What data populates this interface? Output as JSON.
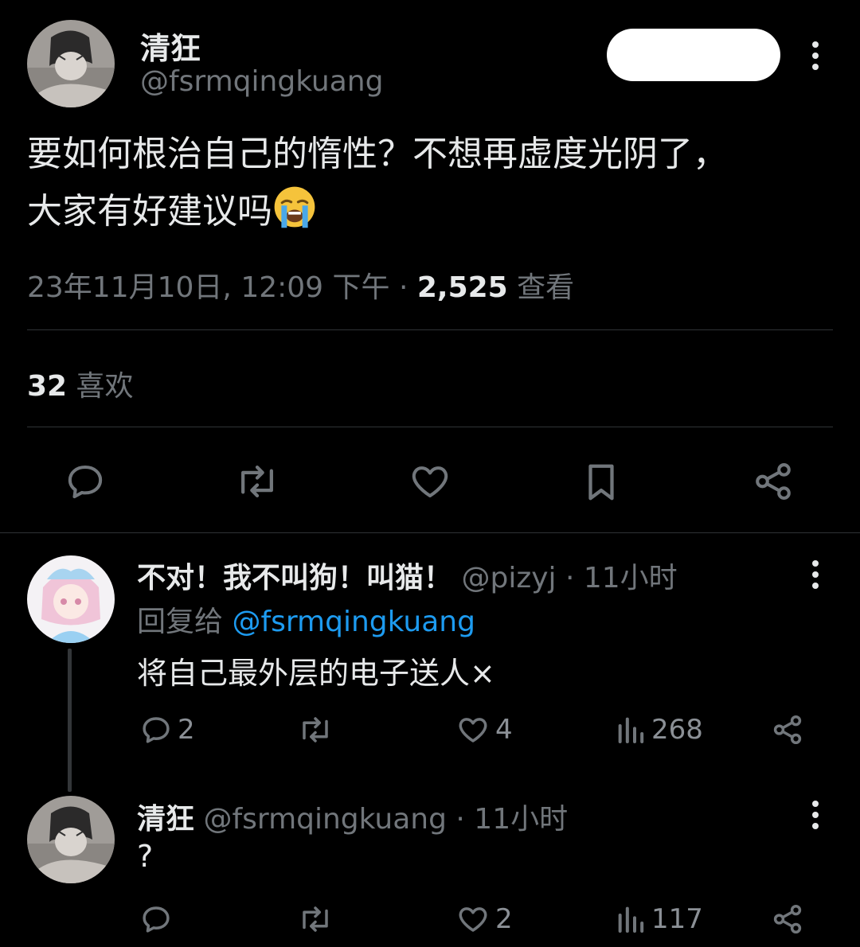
{
  "main_tweet": {
    "display_name": "清狂",
    "handle": "@fsrmqingkuang",
    "follow_label": "",
    "text_line1": "要如何根治自己的惰性？不想再虚度光阴了，",
    "text_line2": "大家有好建议吗",
    "emoji": "loudly-crying-face",
    "timestamp": "23年11月10日, 12:09 下午",
    "separator": " · ",
    "views_count": "2,525",
    "views_label": " 查看",
    "likes_count": "32",
    "likes_label": " 喜欢"
  },
  "replies": [
    {
      "display_name": "不对！我不叫狗！叫猫！",
      "handle": "@pizyj",
      "time": " · 11小时",
      "reply_to_prefix": "回复给 ",
      "reply_to_handle": "@fsrmqingkuang",
      "text": "将自己最外层的电子送人×",
      "reply_count": "2",
      "retweet_count": "",
      "like_count": "4",
      "view_count": "268"
    },
    {
      "display_name": "清狂",
      "handle": "@fsrmqingkuang",
      "time": " · 11小时",
      "text": "?",
      "reply_count": "",
      "retweet_count": "",
      "like_count": "2",
      "view_count": "117"
    }
  ],
  "colors": {
    "background": "#000000",
    "text": "#e7e9ea",
    "muted": "#71767b",
    "link": "#1d9bf0",
    "divider": "#2f3336"
  }
}
